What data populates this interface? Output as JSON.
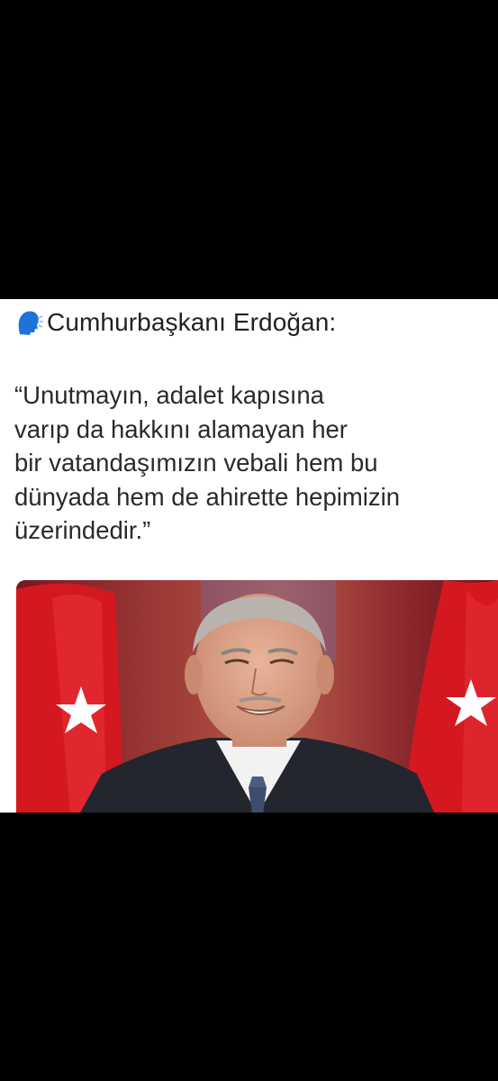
{
  "post": {
    "speaker_icon": "speaking-head-icon",
    "speaker": "Cumhurbaşkanı Erdoğan:",
    "quote_lines": [
      "“Unutmayın, adalet kapısına",
      "varıp da hakkını alamayan her",
      "bir vatandaşımızın vebali hem bu",
      "dünyada hem de ahirette hepimizin",
      "üzerindedir.”"
    ],
    "photo_icon": "portrait-photo"
  },
  "colors": {
    "page_background": "#000000",
    "card_background": "#ffffff",
    "flag_red": "#d41820",
    "icon_blue": "#1e73d8"
  }
}
